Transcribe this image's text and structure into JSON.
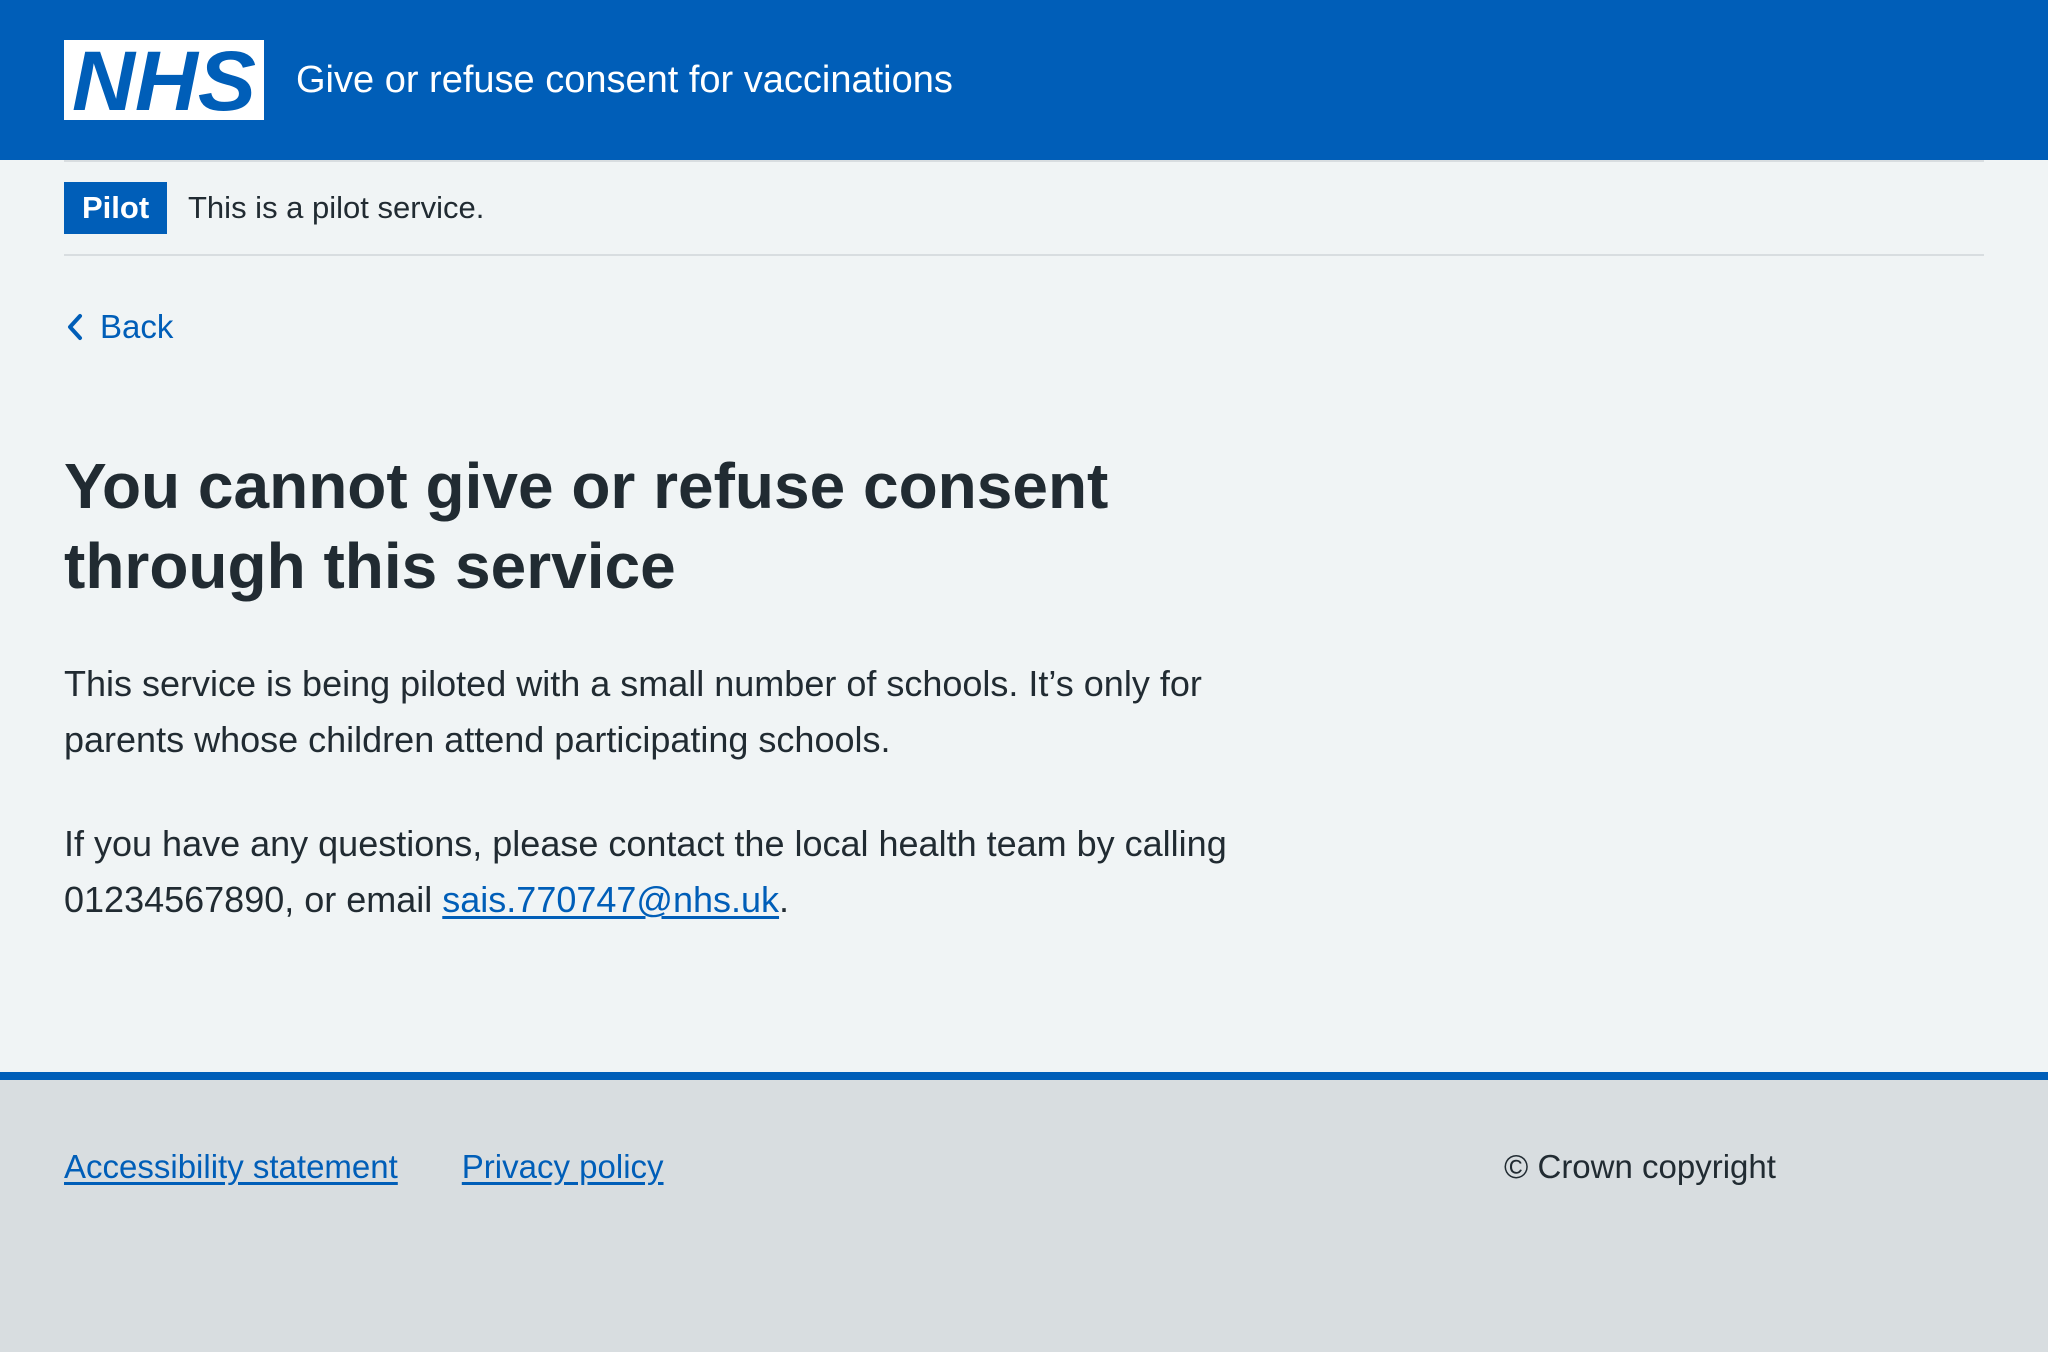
{
  "header": {
    "logo_text": "NHS",
    "service_name": "Give or refuse consent for vaccinations"
  },
  "pilot_banner": {
    "tag": "Pilot",
    "text": "This is a pilot service."
  },
  "back_link": {
    "label": "Back",
    "icon": "chevron-left-icon"
  },
  "main": {
    "title": "You cannot give or refuse consent through this service",
    "para1": "This service is being piloted with a small number of schools. It’s only for parents whose children attend participating schools.",
    "para2_prefix": "If you have any questions, please contact the local health team by calling 01234567890, or email ",
    "para2_email": "sais.770747@nhs.uk",
    "para2_suffix": "."
  },
  "footer": {
    "links": [
      "Accessibility statement",
      "Privacy policy"
    ],
    "copyright": "© Crown copyright"
  },
  "colors": {
    "brand_blue": "#005eb8",
    "page_background": "#f0f4f5",
    "footer_background": "#d8dde0",
    "text": "#212b32",
    "white": "#ffffff"
  }
}
